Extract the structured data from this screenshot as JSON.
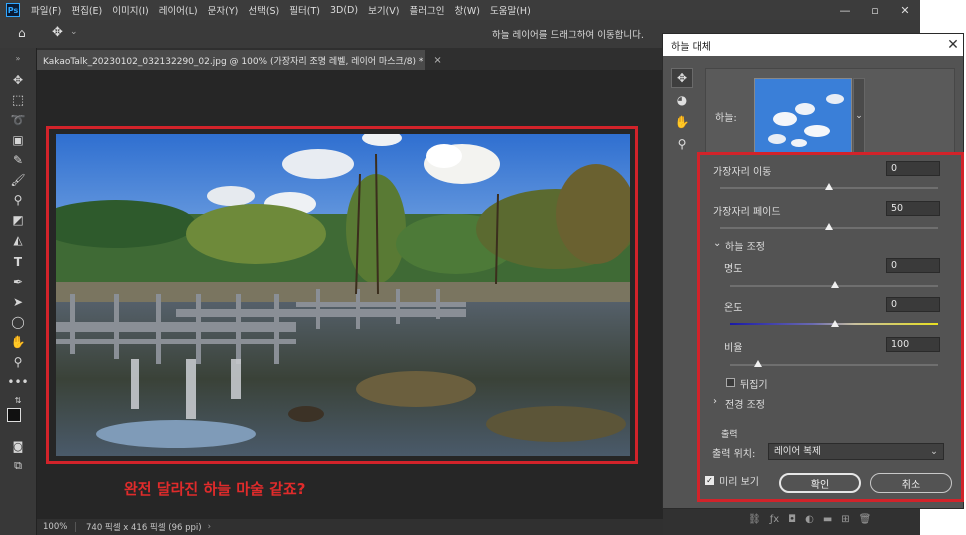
{
  "menubar": {
    "app_icon": "Ps",
    "items": [
      "파일(F)",
      "편집(E)",
      "이미지(I)",
      "레이어(L)",
      "문자(Y)",
      "선택(S)",
      "필터(T)",
      "3D(D)",
      "보기(V)",
      "플러그인",
      "창(W)",
      "도움말(H)"
    ],
    "window_controls": [
      "minimize-icon",
      "restore-icon",
      "close-icon"
    ]
  },
  "options_bar": {
    "hint": "하늘 레이어를 드래그하여 이동합니다."
  },
  "document": {
    "tab_title": "KakaoTalk_20230102_032132290_02.jpg @ 100% (가장자리 조명 레벨, 레이어 마스크/8) *",
    "tab_close": "×",
    "caption": "완전 달라진 하늘  마술 같죠?",
    "zoom": "100%",
    "info": "740 픽셀 x 416 픽셀 (96 ppi)",
    "info_arrow": "›"
  },
  "dialog": {
    "title": "하늘 대체",
    "close": "✕",
    "sky_label": "하늘:",
    "sky_dropdown": "⌄",
    "edge_shift_label": "가장자리 이동",
    "edge_shift_value": "0",
    "edge_fade_label": "가장자리 페이드",
    "edge_fade_value": "50",
    "sky_adjust_label": "하늘 조정",
    "brightness_label": "명도",
    "brightness_value": "0",
    "temperature_label": "온도",
    "temperature_value": "0",
    "scale_label": "비율",
    "scale_value": "100",
    "flip_label": "뒤집기",
    "foreground_label": "전경 조정",
    "output_section": "출력",
    "output_to_label": "출력 위치:",
    "output_to_value": "레이어 복제",
    "preview_label": "미리 보기",
    "ok_label": "확인",
    "cancel_label": "취소",
    "slider_levels_percent": {
      "edge_shift": 50,
      "edge_fade": 50,
      "brightness": 50,
      "temperature": 50,
      "scale": 13
    }
  },
  "colors": {
    "annotation_red": "#d2232a",
    "temperature_gradient": [
      "#1a1aa8",
      "#e8e020"
    ]
  }
}
